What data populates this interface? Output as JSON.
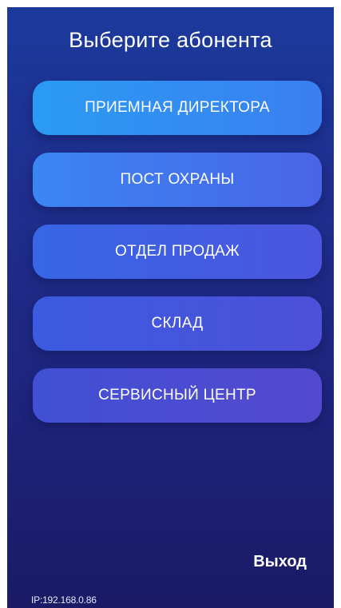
{
  "screen": {
    "title": "Выберите абонента"
  },
  "subscribers": [
    {
      "label": "ПРИЕМНАЯ ДИРЕКТОРА"
    },
    {
      "label": "ПОСТ ОХРАНЫ"
    },
    {
      "label": "ОТДЕЛ ПРОДАЖ"
    },
    {
      "label": "СКЛАД"
    },
    {
      "label": "СЕРВИСНЫЙ ЦЕНТР"
    }
  ],
  "footer": {
    "exit_label": "Выход",
    "ip_text": "IP:192.168.0.86"
  },
  "colors": {
    "background_top": "#1b3a9c",
    "background_bottom": "#1a1a66",
    "button_first": "#2a9bf3",
    "button_last": "#5349cf",
    "text": "#ffffff"
  }
}
